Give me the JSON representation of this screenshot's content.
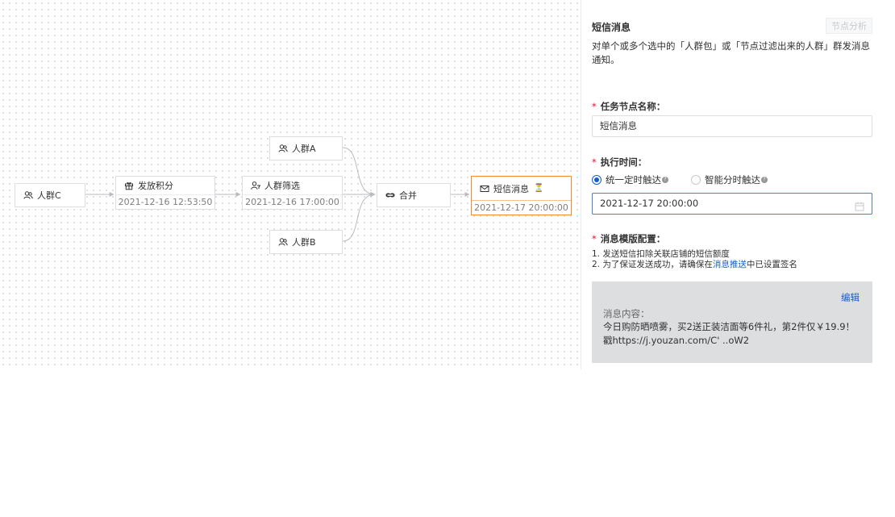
{
  "canvas": {
    "nodes": [
      {
        "id": "crowd_c",
        "icon": "crowd-icon",
        "label": "人群C"
      },
      {
        "id": "points",
        "icon": "gift-icon",
        "label": "发放积分",
        "time": "2021-12-16 12:53:50"
      },
      {
        "id": "filter",
        "icon": "user-filter-icon",
        "label": "人群筛选",
        "time": "2021-12-16 17:00:00"
      },
      {
        "id": "crowd_a",
        "icon": "crowd-icon",
        "label": "人群A"
      },
      {
        "id": "crowd_b",
        "icon": "crowd-icon",
        "label": "人群B"
      },
      {
        "id": "merge",
        "icon": "merge-icon",
        "label": "合并"
      },
      {
        "id": "sms",
        "icon": "mail-icon",
        "label": "短信消息",
        "time": "2021-12-17 20:00:00",
        "status_icon": "hourglass-icon"
      }
    ]
  },
  "panel": {
    "title": "短信消息",
    "analysis_button": "节点分析",
    "description": "对单个或多个选中的「人群包」或「节点过滤出来的人群」群发消息通知。",
    "name_field": {
      "label": "任务节点名称：",
      "value": "短信消息"
    },
    "exec_time": {
      "label": "执行时间：",
      "option_fixed": "统一定时触达",
      "option_smart": "智能分时触达",
      "value": "2021-12-17 20:00:00"
    },
    "template": {
      "label": "消息模版配置：",
      "tip1": "1. 发送短信扣除关联店铺的短信额度",
      "tip2_prefix": "2. 为了保证发送成功，请确保在",
      "tip2_link": "消息推送",
      "tip2_suffix": "中已设置签名",
      "edit_label": "编辑",
      "content_label": "消息内容：",
      "content_text": "今日购防晒喷雾，买2送正装洁面等6件礼，第2件仅￥19.9！戳https://j.youzan.com/C' ..oW2"
    }
  },
  "colors": {
    "primary": "#155bd4",
    "active_node_border": "#ee8a2f",
    "required": "#ee0a24"
  }
}
